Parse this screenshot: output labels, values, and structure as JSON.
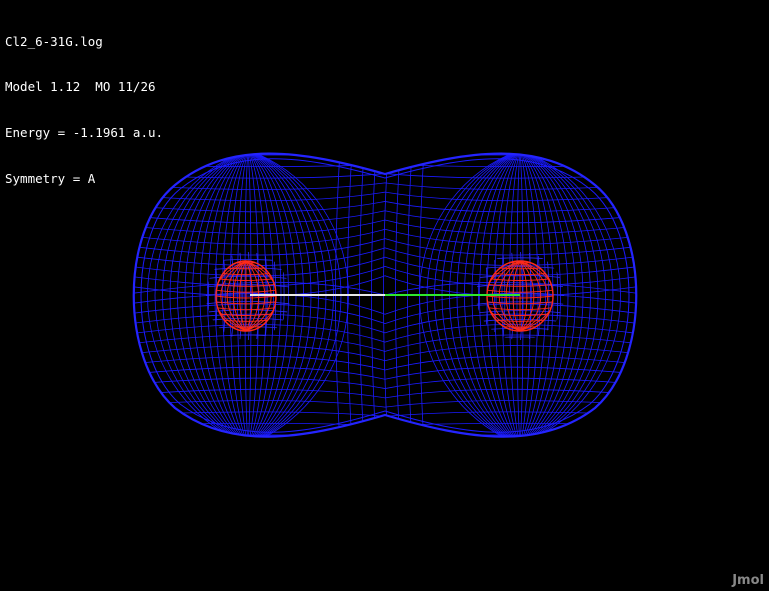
{
  "info": {
    "file": "Cl2_6-31G.log",
    "model_line": "Model 1.12  MO 11/26",
    "energy_line": "Energy = -1.1961 a.u.",
    "symmetry_line": "Symmetry = A"
  },
  "colors": {
    "background": "#000000",
    "text": "#ffffff",
    "outer_isosurface": "#1a1aff",
    "inner_isosurface": "#ff2a1a",
    "bond_left": "#e8e8e8",
    "bond_right": "#2ee82e"
  },
  "molecule": {
    "atoms": [
      "Cl",
      "Cl"
    ],
    "bond": "Cl-Cl"
  },
  "logo": "Jmol"
}
